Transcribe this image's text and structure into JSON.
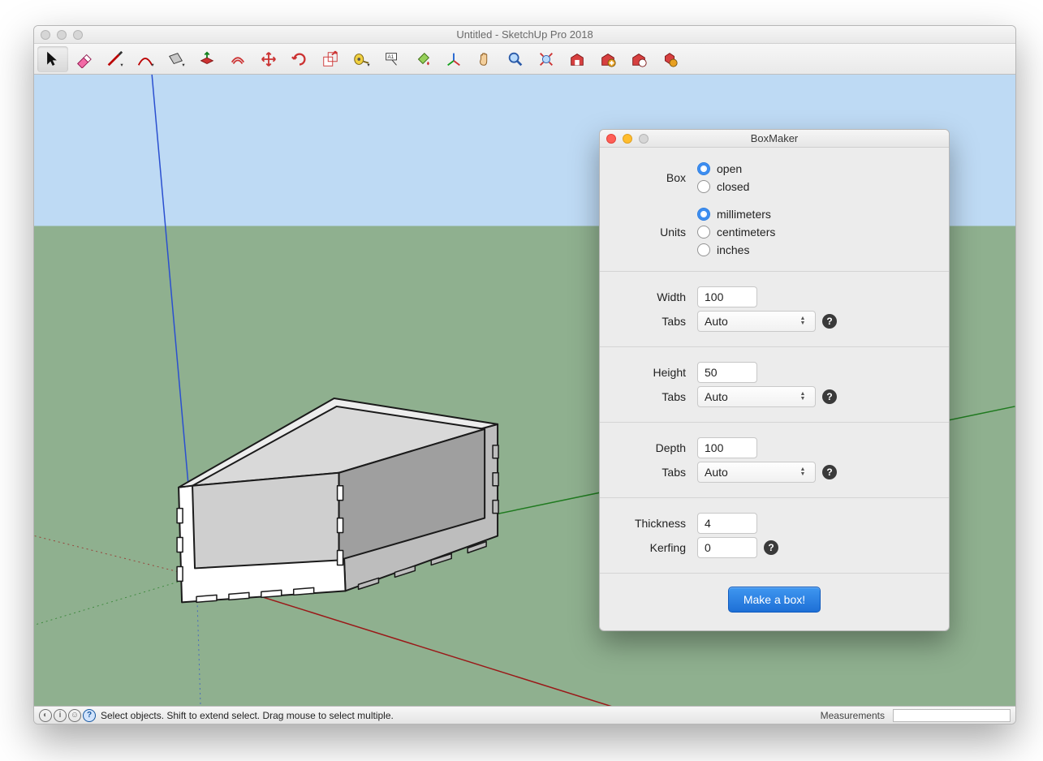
{
  "window": {
    "title": "Untitled - SketchUp Pro 2018"
  },
  "toolbar": {
    "tools": [
      "select",
      "eraser",
      "line",
      "arc",
      "rectangle",
      "push-pull",
      "offset",
      "move",
      "rotate",
      "scale",
      "tape-measure",
      "text",
      "paint-bucket",
      "axes",
      "pan",
      "zoom",
      "zoom-extents",
      "3d-warehouse",
      "extension-warehouse",
      "layers",
      "add-location"
    ]
  },
  "statusbar": {
    "hint": "Select objects. Shift to extend select. Drag mouse to select multiple.",
    "measurements_label": "Measurements",
    "measurements_value": ""
  },
  "dialog": {
    "title": "BoxMaker",
    "box": {
      "label": "Box",
      "options": {
        "open": "open",
        "closed": "closed"
      },
      "selected": "open"
    },
    "units": {
      "label": "Units",
      "options": {
        "mm": "millimeters",
        "cm": "centimeters",
        "in": "inches"
      },
      "selected": "mm"
    },
    "width": {
      "label": "Width",
      "value": "100",
      "tabs_label": "Tabs",
      "tabs_value": "Auto"
    },
    "height": {
      "label": "Height",
      "value": "50",
      "tabs_label": "Tabs",
      "tabs_value": "Auto"
    },
    "depth": {
      "label": "Depth",
      "value": "100",
      "tabs_label": "Tabs",
      "tabs_value": "Auto"
    },
    "thickness": {
      "label": "Thickness",
      "value": "4"
    },
    "kerfing": {
      "label": "Kerfing",
      "value": "0"
    },
    "submit": "Make a box!"
  }
}
